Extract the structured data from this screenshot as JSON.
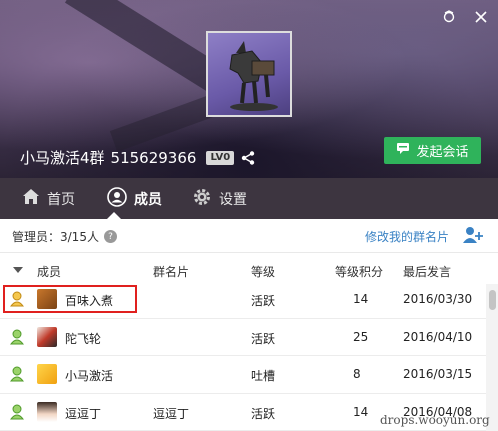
{
  "group": {
    "name": "小马激活4群",
    "id": "515629366",
    "level_badge": "LV0"
  },
  "buttons": {
    "start_chat": "发起会话"
  },
  "tabs": [
    {
      "label": "首页",
      "icon": "home-icon"
    },
    {
      "label": "成员",
      "icon": "member-icon",
      "active": true
    },
    {
      "label": "设置",
      "icon": "gear-icon"
    }
  ],
  "admin": {
    "label": "管理员：3/15人",
    "edit_card": "修改我的群名片"
  },
  "table": {
    "headers": [
      "成员",
      "群名片",
      "等级",
      "等级积分",
      "最后发言"
    ],
    "rows": [
      {
        "nick": "百味入煮",
        "card": "",
        "level": "活跃",
        "points": "14",
        "date": "2016/03/30"
      },
      {
        "nick": "陀飞轮",
        "card": "",
        "level": "活跃",
        "points": "25",
        "date": "2016/04/10"
      },
      {
        "nick": "小马激活",
        "card": "",
        "level": "吐槽",
        "points": "8",
        "date": "2016/03/15"
      },
      {
        "nick": "逗逗丁",
        "card": "逗逗丁",
        "level": "活跃",
        "points": "14",
        "date": "2016/04/08"
      }
    ]
  },
  "watermark": "drops.wooyun.org",
  "colors": {
    "accent_green": "#2fb35b",
    "link_blue": "#3a82c4",
    "highlight_red": "#e0201e",
    "tab_bar": "#3d3540"
  }
}
